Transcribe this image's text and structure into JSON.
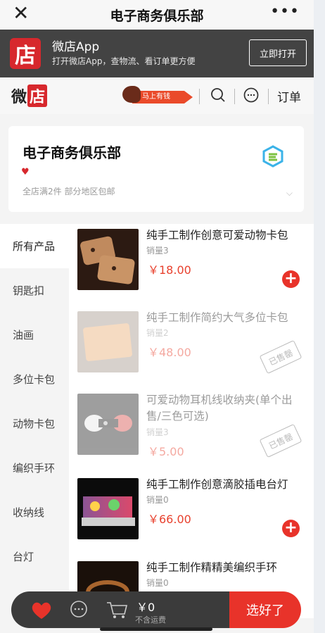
{
  "topbar": {
    "close_glyph": "✕",
    "title": "电子商务俱乐部",
    "more_glyph": "•••"
  },
  "app_banner": {
    "logo_text": "店",
    "name": "微店App",
    "desc": "打开微店App，查物流、看订单更方便",
    "open_label": "立即打开"
  },
  "header": {
    "logo_text_plain": "微",
    "logo_text_red": "店",
    "promo_label": "马上有钱",
    "orders_label": "订单"
  },
  "store": {
    "name": "电子商务俱乐部",
    "heart_glyph": "♥",
    "shipping": "全店满2件 部分地区包邮",
    "chevron": "⌵"
  },
  "categories": [
    {
      "label": "所有产品",
      "active": true
    },
    {
      "label": "钥匙扣",
      "active": false
    },
    {
      "label": "油画",
      "active": false
    },
    {
      "label": "多位卡包",
      "active": false
    },
    {
      "label": "动物卡包",
      "active": false
    },
    {
      "label": "编织手环",
      "active": false
    },
    {
      "label": "收纳线",
      "active": false
    },
    {
      "label": "台灯",
      "active": false
    }
  ],
  "products": [
    {
      "title": "纯手工制作创意可爱动物卡包",
      "sales": "销量3",
      "price": "￥18.00",
      "sold_out": false
    },
    {
      "title": "纯手工制作简约大气多位卡包",
      "sales": "销量2",
      "price": "￥48.00",
      "sold_out": true,
      "stamp": "已售罄"
    },
    {
      "title": "可爱动物耳机线收纳夹(单个出售/三色可选)",
      "sales": "销量3",
      "price": "￥5.00",
      "sold_out": true,
      "stamp": "已售罄"
    },
    {
      "title": "纯手工制作创意滴胶插电台灯",
      "sales": "销量0",
      "price": "￥66.00",
      "sold_out": false
    },
    {
      "title": "纯手工制作精精美编织手环",
      "sales": "销量0",
      "price": "",
      "sold_out": false
    }
  ],
  "add_glyph": "+",
  "cart": {
    "amount": "￥0",
    "shipping_note": "不含运费",
    "checkout_label": "选好了"
  },
  "colors": {
    "accent": "#e8332a",
    "banner_bg": "#434343",
    "brand_red": "#d7282d"
  }
}
